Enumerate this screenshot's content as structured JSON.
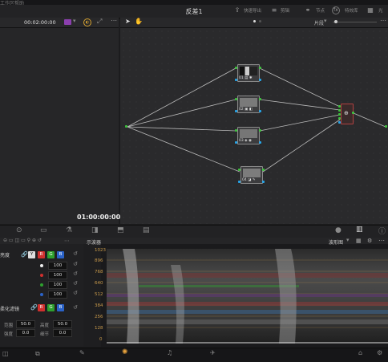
{
  "menubar": {
    "items": [
      "工作区",
      "帮助"
    ]
  },
  "header": {
    "title": "反差1",
    "actions": [
      {
        "label": "快速导出",
        "icon": "export-icon"
      },
      {
        "label": "剪辑",
        "icon": "timeline-icon"
      },
      {
        "label": "节点",
        "icon": "node-icon"
      },
      {
        "label": "特效库",
        "icon": "fx-icon"
      },
      {
        "label": "光",
        "icon": "light-icon"
      }
    ]
  },
  "viewer": {
    "timecode_top": "00:02:00:00",
    "timecode_bottom": "01:00:00:00"
  },
  "node_editor": {
    "zoom_label": "片段",
    "nodes": [
      {
        "label": "01"
      },
      {
        "label": "02"
      },
      {
        "label": "03"
      },
      {
        "label": "04"
      }
    ]
  },
  "scopes": {
    "title": "示波器",
    "mode": "波形图",
    "y_labels": [
      "1023",
      "896",
      "768",
      "640",
      "512",
      "384",
      "256",
      "128",
      "0"
    ]
  },
  "primaries": {
    "section1": "亮度",
    "channels": [
      "Y",
      "R",
      "G",
      "B"
    ],
    "values": [
      "100",
      "100",
      "100",
      "100"
    ],
    "section2": "柔化滤镜",
    "params": [
      {
        "label": "范围",
        "value": "50.0",
        "label2": "高度",
        "value2": "50.0"
      },
      {
        "label": "强度",
        "value": "0.0",
        "label2": "细节",
        "value2": "0.0"
      }
    ]
  },
  "colors": {
    "accent": "#e7a23c",
    "green_pin": "#3ec13e",
    "blue_pin": "#27a5e8"
  }
}
